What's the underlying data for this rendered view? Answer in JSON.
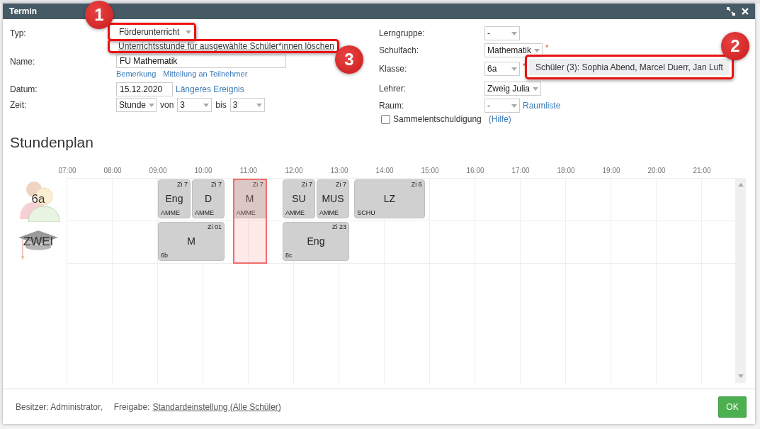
{
  "window": {
    "title": "Termin"
  },
  "typ": {
    "label": "Typ:",
    "value": "Förderunterricht",
    "annotation": "1"
  },
  "delete_link": {
    "text": "Unterrichtsstunde für ausgewählte Schüler*innen löschen",
    "annotation": "3"
  },
  "name": {
    "label": "Name:",
    "value": "FU Mathematik",
    "links": [
      "Bemerkung",
      "Mitteilung an Teilnehmer"
    ]
  },
  "datum": {
    "label": "Datum:",
    "value": "15.12.2020",
    "link": "Längeres Ereignis"
  },
  "zeit": {
    "label": "Zeit:",
    "mode": "Stunde",
    "from_label": "von",
    "from": "3",
    "to_label": "bis",
    "to": "3"
  },
  "right_fields": [
    {
      "label": "Lerngruppe:",
      "value": "-"
    },
    {
      "label": "Schulfach:",
      "value": "Mathematik",
      "marker": "*"
    },
    {
      "label": "Klasse:",
      "value": "6a",
      "marker": "*"
    },
    {
      "label": "Lehrer:",
      "value": "Zweig Julia"
    },
    {
      "label": "Raum:",
      "value": "-",
      "link": "Raumliste"
    }
  ],
  "checkbox": {
    "label": "Sammelentschuldigung",
    "checked": false,
    "help": "(Hilfe)"
  },
  "tooltip": {
    "text": "Schüler (3): Sophia Abend, Marcel Duerr, Jan Luft",
    "annotation": "2"
  },
  "schedule": {
    "title": "Stundenplan",
    "hours": [
      "07:00",
      "08:00",
      "09:00",
      "10:00",
      "11:00",
      "12:00",
      "13:00",
      "14:00",
      "15:00",
      "16:00",
      "17:00",
      "18:00",
      "19:00",
      "20:00",
      "21:00"
    ],
    "rows": [
      {
        "label": "6a",
        "kind": "class",
        "events": [
          {
            "subject": "Eng",
            "room": "Zi 7",
            "note": "AMME"
          },
          {
            "subject": "D",
            "room": "Zi 7",
            "note": "AMME"
          },
          {
            "subject": "M",
            "room": "Zi 7",
            "note": "AMME"
          },
          {
            "subject": "SU",
            "room": "Zi 7",
            "note": "AMME"
          },
          {
            "subject": "MUS",
            "room": "Zi 7",
            "note": "AMME"
          },
          {
            "subject": "LZ",
            "room": "Zi 6",
            "note": "SCHU"
          }
        ]
      },
      {
        "label": "ZWEI",
        "kind": "teacher",
        "events": [
          {
            "subject": "M",
            "room": "Zi 01",
            "note": "6b"
          },
          {
            "subject": "Eng",
            "room": "Zi 23",
            "note": "8c"
          }
        ]
      }
    ]
  },
  "footer": {
    "owner": "Besitzer: Administrator,",
    "share_label": "Freigabe:",
    "share_link": "Standardeinstellung (Alle Schüler)",
    "ok": "OK"
  }
}
